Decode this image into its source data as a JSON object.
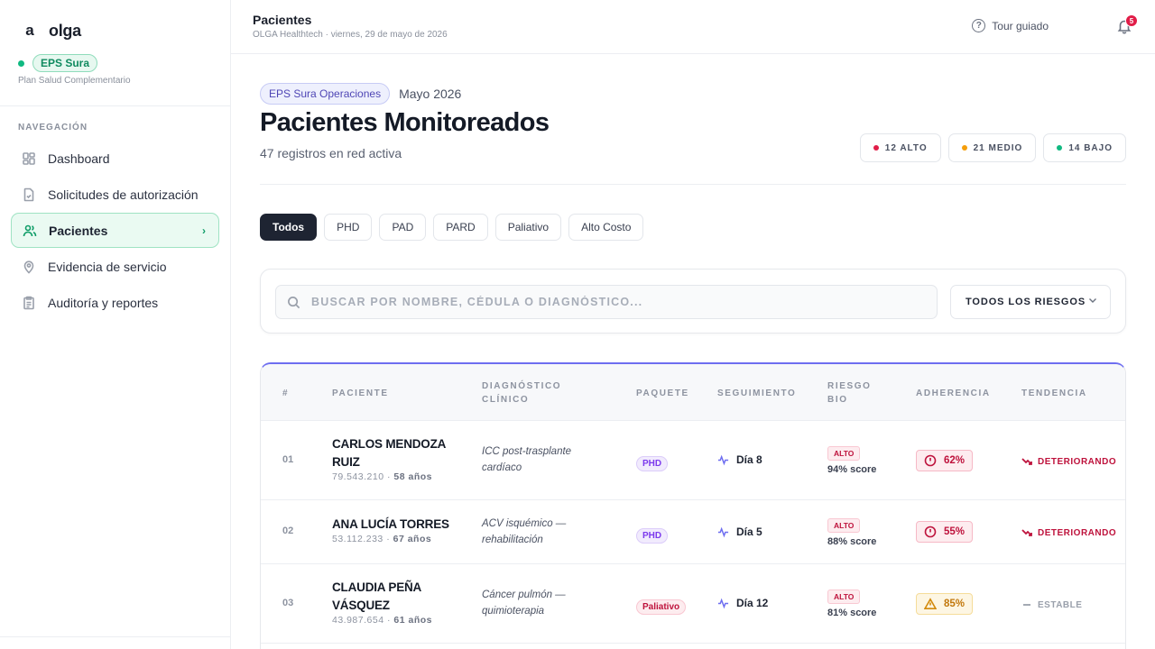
{
  "sidebar": {
    "brand_mark": "a",
    "brand_name": "olga",
    "org_badge": "EPS Sura",
    "org_plan": "Plan Salud Complementario",
    "nav_title": "NAVEGACIÓN",
    "items": [
      {
        "label": "Dashboard",
        "icon": "dashboard-icon"
      },
      {
        "label": "Solicitudes de autorización",
        "icon": "document-check-icon"
      },
      {
        "label": "Pacientes",
        "icon": "users-icon",
        "active": true
      },
      {
        "label": "Evidencia de servicio",
        "icon": "map-pin-icon"
      },
      {
        "label": "Auditoría y reportes",
        "icon": "clipboard-icon"
      }
    ]
  },
  "header": {
    "title": "Pacientes",
    "subtitle": "OLGA Healthtech · viernes, 29 de mayo de 2026",
    "tour_label": "Tour guiado",
    "notification_count": "5"
  },
  "main": {
    "context_badge": "EPS Sura Operaciones",
    "context_date": "Mayo 2026",
    "title": "Pacientes Monitoreados",
    "subtitle": "47 registros en red activa",
    "risk_summary": [
      {
        "label": "12 ALTO",
        "color": "#e11d48"
      },
      {
        "label": "21 MEDIO",
        "color": "#f59e0b"
      },
      {
        "label": "14 BAJO",
        "color": "#10b981"
      }
    ],
    "tabs": [
      "Todos",
      "PHD",
      "PAD",
      "PARD",
      "Paliativo",
      "Alto Costo"
    ],
    "active_tab": "Todos",
    "search": {
      "placeholder": "BUSCAR POR NOMBRE, CÉDULA O DIAGNÓSTICO...",
      "value": ""
    },
    "risk_filter": "TODOS LOS RIESGOS"
  },
  "table": {
    "columns": [
      "#",
      "PACIENTE",
      "DIAGNÓSTICO CLÍNICO",
      "PAQUETE",
      "SEGUIMIENTO",
      "RIESGO BIO",
      "ADHERENCIA",
      "TENDENCIA"
    ],
    "rows": [
      {
        "num": "01",
        "name": "CARLOS MENDOZA RUIZ",
        "id": "79.543.210",
        "age": "58 años",
        "diagnosis": "ICC post-trasplante cardíaco",
        "package": "PHD",
        "follow_up": "Día 8",
        "risk_level": "ALTO",
        "risk_score": "94% score",
        "adherence": "62%",
        "trend": "DETERIORANDO"
      },
      {
        "num": "02",
        "name": "ANA LUCÍA TORRES",
        "id": "53.112.233",
        "age": "67 años",
        "diagnosis": "ACV isquémico — rehabilitación",
        "package": "PHD",
        "follow_up": "Día 5",
        "risk_level": "ALTO",
        "risk_score": "88% score",
        "adherence": "55%",
        "trend": "DETERIORANDO"
      },
      {
        "num": "03",
        "name": "CLAUDIA PEÑA VÁSQUEZ",
        "id": "43.987.654",
        "age": "61 años",
        "diagnosis": "Cáncer pulmón — quimioterapia",
        "package": "Paliativo",
        "follow_up": "Día 12",
        "risk_level": "ALTO",
        "risk_score": "81% score",
        "adherence": "85%",
        "trend": "ESTABLE"
      }
    ]
  }
}
